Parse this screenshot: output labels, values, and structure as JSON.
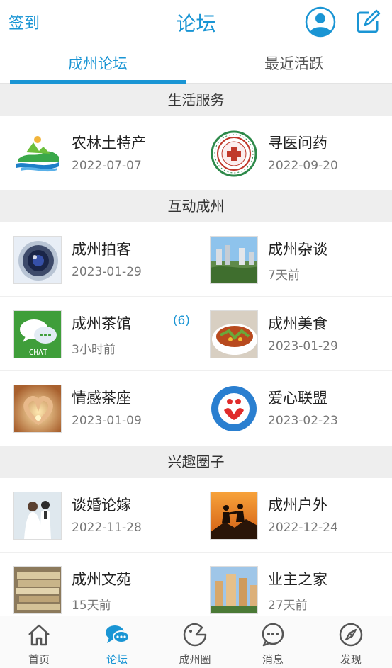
{
  "header": {
    "checkin_label": "签到",
    "title": "论坛"
  },
  "tabs": [
    {
      "label": "成州论坛",
      "active": true
    },
    {
      "label": "最近活跃",
      "active": false
    }
  ],
  "sections": [
    {
      "title": "生活服务",
      "items": [
        {
          "name": "农林土特产",
          "date": "2022-07-07",
          "icon": "landscape-logo"
        },
        {
          "name": "寻医问药",
          "date": "2022-09-20",
          "icon": "hospital-seal"
        }
      ]
    },
    {
      "title": "互动成州",
      "items": [
        {
          "name": "成州拍客",
          "date": "2023-01-29",
          "icon": "camera-lens"
        },
        {
          "name": "成州杂谈",
          "date": "7天前",
          "icon": "city-photo"
        },
        {
          "name": "成州茶馆",
          "date": "3小时前",
          "count": "(6)",
          "icon": "chat-bubbles"
        },
        {
          "name": "成州美食",
          "date": "2023-01-29",
          "icon": "food-bowl"
        },
        {
          "name": "情感茶座",
          "date": "2023-01-09",
          "icon": "heart-hands"
        },
        {
          "name": "爱心联盟",
          "date": "2023-02-23",
          "icon": "charity-logo"
        }
      ]
    },
    {
      "title": "兴趣圈子",
      "items": [
        {
          "name": "谈婚论嫁",
          "date": "2022-11-28",
          "icon": "wedding-photo"
        },
        {
          "name": "成州户外",
          "date": "2022-12-24",
          "icon": "hikers-sunset"
        },
        {
          "name": "成州文苑",
          "date": "15天前",
          "icon": "books-stack"
        },
        {
          "name": "业主之家",
          "date": "27天前",
          "icon": "buildings"
        }
      ]
    }
  ],
  "bottom_nav": [
    {
      "label": "首页",
      "icon": "home-icon",
      "active": false
    },
    {
      "label": "论坛",
      "icon": "chat-icon",
      "active": true
    },
    {
      "label": "成州圈",
      "icon": "circle-icon",
      "active": false
    },
    {
      "label": "消息",
      "icon": "message-icon",
      "active": false
    },
    {
      "label": "发现",
      "icon": "compass-icon",
      "active": false
    }
  ],
  "colors": {
    "accent": "#1a95d4",
    "section_bg": "#eeeeee",
    "secondary_text": "#777777"
  }
}
